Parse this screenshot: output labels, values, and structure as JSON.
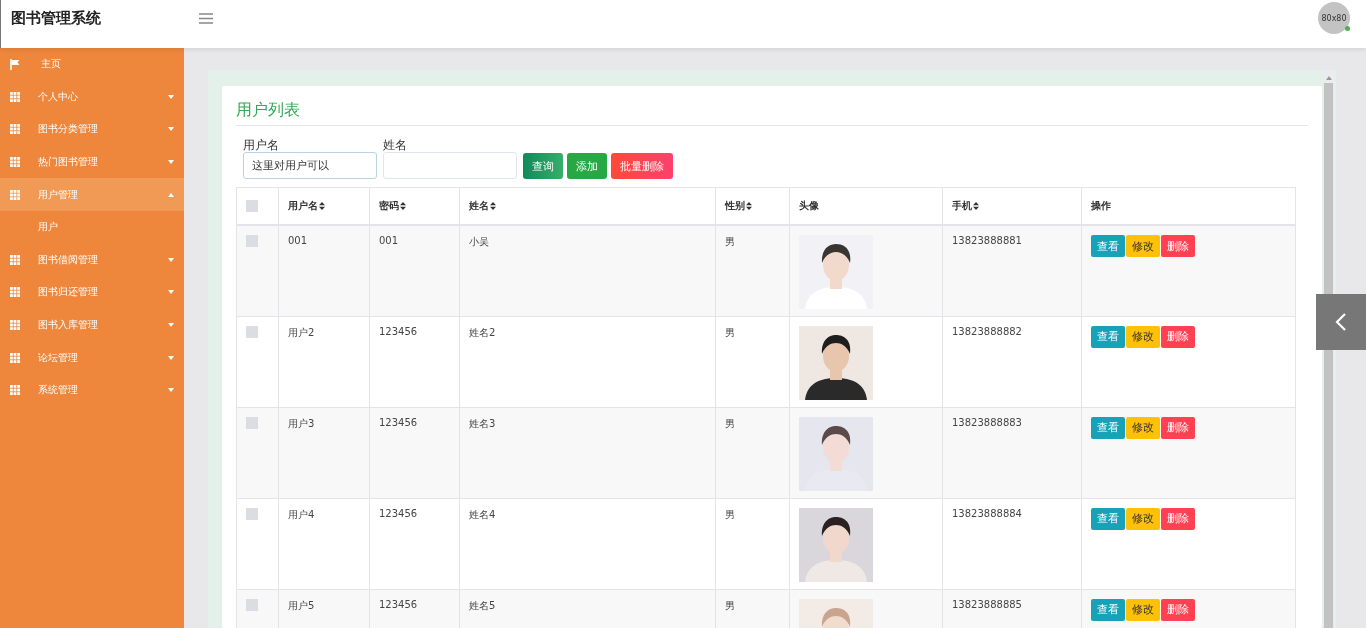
{
  "header": {
    "title": "图书管理系统",
    "avatar_text": "80x80",
    "online": true
  },
  "sidebar": {
    "items": [
      {
        "kind": "home",
        "label": "主页"
      },
      {
        "kind": "menu",
        "label": "个人中心",
        "expanded": false
      },
      {
        "kind": "menu",
        "label": "图书分类管理",
        "expanded": false
      },
      {
        "kind": "menu",
        "label": "热门图书管理",
        "expanded": false
      },
      {
        "kind": "menu",
        "label": "用户管理",
        "expanded": true,
        "children": [
          {
            "label": "用户"
          }
        ]
      },
      {
        "kind": "menu",
        "label": "图书借阅管理",
        "expanded": false
      },
      {
        "kind": "menu",
        "label": "图书归还管理",
        "expanded": false
      },
      {
        "kind": "menu",
        "label": "图书入库管理",
        "expanded": false
      },
      {
        "kind": "menu",
        "label": "论坛管理",
        "expanded": false
      },
      {
        "kind": "menu",
        "label": "系统管理",
        "expanded": false
      }
    ]
  },
  "panel": {
    "title": "用户列表",
    "search": [
      {
        "label": "用户名",
        "value": "这里对用户可以"
      },
      {
        "label": "姓名"
      }
    ],
    "buttons": [
      {
        "kind": "query",
        "label": "查询"
      },
      {
        "kind": "add",
        "label": "添加"
      },
      {
        "kind": "delete",
        "label": "批量删除"
      }
    ],
    "table": {
      "header_checked": false,
      "columns": [
        {
          "label": "用户名",
          "sortable": true
        },
        {
          "label": "密码",
          "sortable": true
        },
        {
          "label": "姓名",
          "sortable": true
        },
        {
          "label": "性别",
          "sortable": true
        },
        {
          "label": "头像",
          "sortable": false
        },
        {
          "label": "手机",
          "sortable": true
        },
        {
          "label": "操作",
          "sortable": false
        }
      ],
      "rows": [
        {
          "checked": false,
          "username": "001",
          "password": "001",
          "name": "小吴",
          "gender": "男",
          "phone": "13823888881",
          "actions": [
            "查看",
            "修改",
            "删除"
          ]
        },
        {
          "checked": false,
          "username": "用户2",
          "password": "123456",
          "name": "姓名2",
          "gender": "男",
          "phone": "13823888882",
          "actions": [
            "查看",
            "修改",
            "删除"
          ]
        },
        {
          "checked": false,
          "username": "用户3",
          "password": "123456",
          "name": "姓名3",
          "gender": "男",
          "phone": "13823888883",
          "actions": [
            "查看",
            "修改",
            "删除"
          ]
        },
        {
          "checked": false,
          "username": "用户4",
          "password": "123456",
          "name": "姓名4",
          "gender": "男",
          "phone": "13823888884",
          "actions": [
            "查看",
            "修改",
            "删除"
          ]
        },
        {
          "checked": false,
          "username": "用户5",
          "password": "123456",
          "name": "姓名5",
          "gender": "男",
          "phone": "13823888885",
          "actions": [
            "查看",
            "修改",
            "删除"
          ]
        }
      ]
    }
  }
}
